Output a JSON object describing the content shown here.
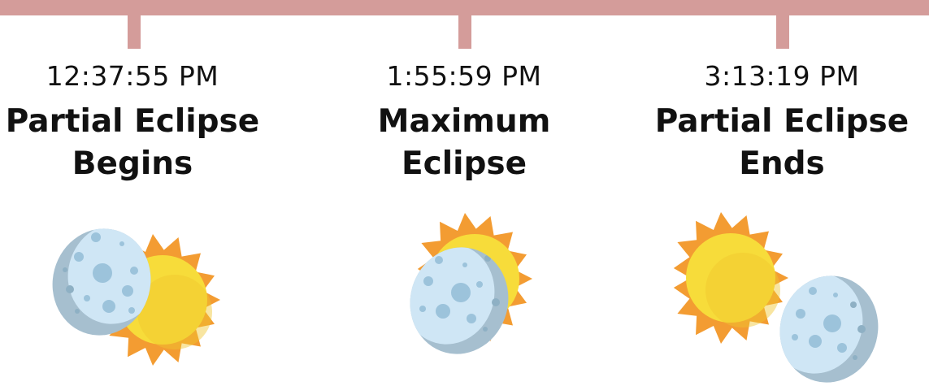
{
  "timeline": {
    "events": [
      {
        "time": "12:37:55 PM",
        "label_line1": "Partial Eclipse",
        "label_line2": "Begins",
        "illustration": "moon-partially-covering-sun-icon"
      },
      {
        "time": "1:55:59 PM",
        "label_line1": "Maximum",
        "label_line2": "Eclipse",
        "illustration": "moon-covering-sun-icon"
      },
      {
        "time": "3:13:19 PM",
        "label_line1": "Partial Eclipse",
        "label_line2": "Ends",
        "illustration": "moon-leaving-sun-icon"
      }
    ]
  },
  "colors": {
    "timeline": "#d49c9a",
    "sun_core": "#f7dc3a",
    "sun_rays": "#f39c32",
    "moon_light": "#cfe6f5",
    "moon_shadow": "#a6bfcf",
    "crater": "#9cc3db"
  }
}
